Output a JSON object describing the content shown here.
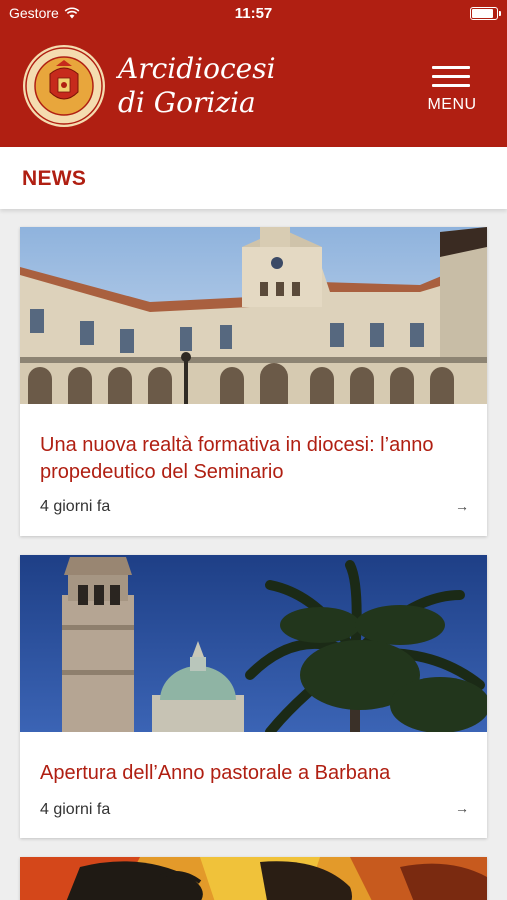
{
  "status_bar": {
    "carrier": "Gestore",
    "time": "11:57",
    "icons": [
      "wifi-icon",
      "battery-icon"
    ]
  },
  "header": {
    "title_line1": "Arcidiocesi",
    "title_line2": "di Gorizia",
    "logo_icon": "diocese-seal-icon",
    "menu_label": "MENU",
    "menu_icon": "hamburger-icon"
  },
  "section": {
    "title": "NEWS"
  },
  "news": [
    {
      "title": "Una nuova realtà formativa in diocesi: l’anno propedeutico del Seminario",
      "time": "4 giorni fa",
      "image": "seminary-courtyard-photo",
      "arrow_icon": "arrow-right-icon"
    },
    {
      "title": "Apertura dell’Anno pastorale a Barbana",
      "time": "4 giorni fa",
      "image": "bell-tower-palm-photo",
      "arrow_icon": "arrow-right-icon"
    },
    {
      "image": "colorful-painting-photo"
    }
  ],
  "colors": {
    "brand_red": "#b01f12",
    "background": "#eeeeee",
    "card": "#ffffff"
  }
}
